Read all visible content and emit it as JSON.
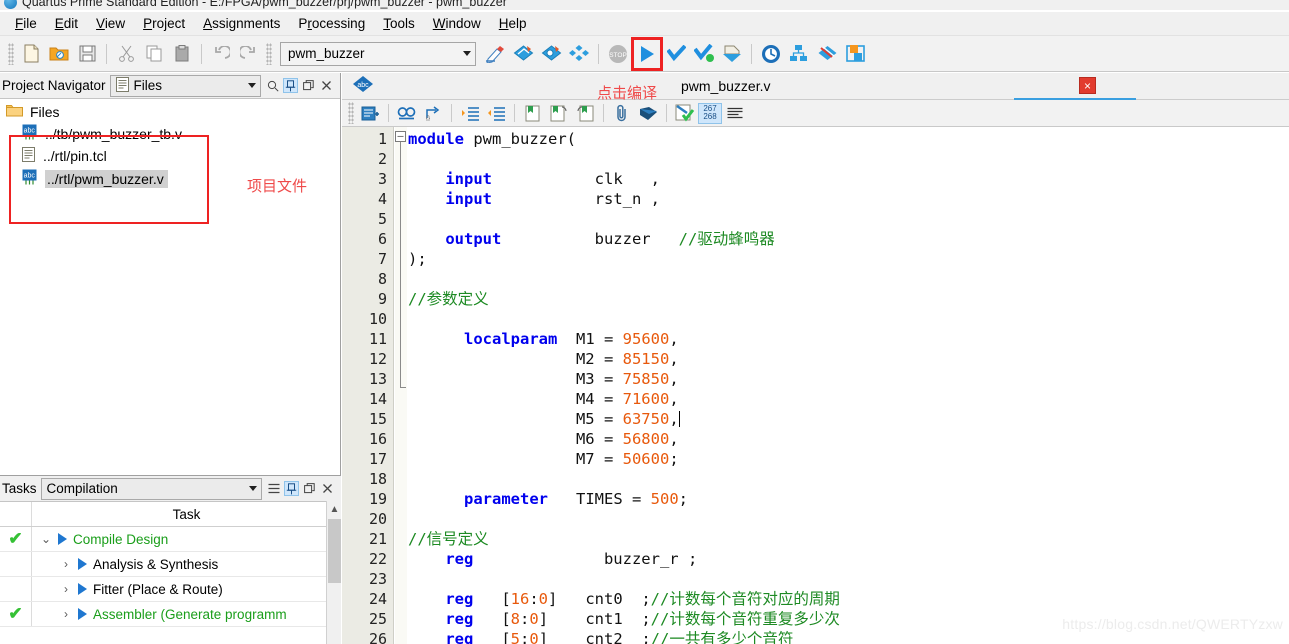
{
  "window": {
    "title": "Quartus Prime Standard Edition - E:/FPGA/pwm_buzzer/prj/pwm_buzzer - pwm_buzzer",
    "logo_icon": "quartus-logo-icon"
  },
  "menubar": {
    "items": [
      {
        "label": "File",
        "mnemonic": "F"
      },
      {
        "label": "Edit",
        "mnemonic": "E"
      },
      {
        "label": "View",
        "mnemonic": "V"
      },
      {
        "label": "Project",
        "mnemonic": "P"
      },
      {
        "label": "Assignments",
        "mnemonic": "A"
      },
      {
        "label": "Processing",
        "mnemonic": "r"
      },
      {
        "label": "Tools",
        "mnemonic": "T"
      },
      {
        "label": "Window",
        "mnemonic": "W"
      },
      {
        "label": "Help",
        "mnemonic": "H"
      }
    ]
  },
  "toolbar": {
    "project_combo_value": "pwm_buzzer",
    "buttons": [
      {
        "name": "new-file-icon",
        "title": "New"
      },
      {
        "name": "open-file-icon",
        "title": "Open"
      },
      {
        "name": "save-icon",
        "title": "Save"
      },
      {
        "name": "cut-icon",
        "title": "Cut"
      },
      {
        "name": "copy-icon",
        "title": "Copy"
      },
      {
        "name": "paste-icon",
        "title": "Paste"
      },
      {
        "name": "undo-icon",
        "title": "Undo"
      },
      {
        "name": "redo-icon",
        "title": "Redo"
      }
    ],
    "buttons2": [
      {
        "name": "rtl-editor-icon",
        "title": "Text Editor"
      },
      {
        "name": "settings-blue-icon",
        "title": "Settings"
      },
      {
        "name": "assignment-editor-icon",
        "title": "Assignment Editor"
      },
      {
        "name": "pin-planner-icon",
        "title": "Pin Planner"
      },
      {
        "name": "stop-icon",
        "title": "Stop Processing"
      },
      {
        "name": "start-compilation-icon",
        "title": "Start Compilation"
      },
      {
        "name": "start-analysis-synthesis-icon",
        "title": "Start Analysis & Synthesis"
      },
      {
        "name": "start-compilation-check-icon",
        "title": "Analysis & Elaboration"
      },
      {
        "name": "programmer-icon",
        "title": "Programmer"
      },
      {
        "name": "timing-analyzer-icon",
        "title": "Timing Analyzer"
      },
      {
        "name": "netlist-viewer-icon",
        "title": "Netlist Viewers"
      },
      {
        "name": "signaltap-icon",
        "title": "SignalTap"
      },
      {
        "name": "chip-planner-icon",
        "title": "Chip Planner"
      }
    ]
  },
  "project_navigator": {
    "panel_title": "Project Navigator",
    "view_combo_value": "Files",
    "view_combo_icon": "document-icon",
    "header_icons": [
      {
        "name": "search-icon",
        "glyph": "⌕",
        "active": false
      },
      {
        "name": "pin-icon",
        "glyph": "⌗",
        "active": true
      },
      {
        "name": "restore-icon",
        "glyph": "❐",
        "active": false
      },
      {
        "name": "close-icon",
        "glyph": "×",
        "active": false
      }
    ],
    "root_label": "Files",
    "root_icon": "folder-icon",
    "files": [
      {
        "label": "../tb/pwm_buzzer_tb.v",
        "icon": "verilog-file-icon",
        "selected": false
      },
      {
        "label": "../rtl/pin.tcl",
        "icon": "text-file-icon",
        "selected": false
      },
      {
        "label": "../rtl/pwm_buzzer.v",
        "icon": "verilog-file-icon",
        "selected": true
      }
    ],
    "annotation": "项目文件"
  },
  "tasks": {
    "panel_title": "Tasks",
    "flow_combo_value": "Compilation",
    "header_icons": [
      {
        "name": "menu-icon",
        "glyph": "≡",
        "active": false
      },
      {
        "name": "pin-icon",
        "glyph": "⌗",
        "active": true
      },
      {
        "name": "restore-icon",
        "glyph": "❐",
        "active": false
      },
      {
        "name": "close-icon",
        "glyph": "×",
        "active": false
      }
    ],
    "column_header": "Task",
    "rows": [
      {
        "status": "✔",
        "done": true,
        "expander": "⌄",
        "label": "Compile Design",
        "green": true,
        "indent": 0
      },
      {
        "status": "",
        "done": false,
        "expander": "›",
        "label": "Analysis & Synthesis",
        "green": false,
        "indent": 1
      },
      {
        "status": "",
        "done": false,
        "expander": "›",
        "label": "Fitter (Place & Route)",
        "green": false,
        "indent": 1
      },
      {
        "status": "✔",
        "done": true,
        "expander": "›",
        "label": "Assembler (Generate programm",
        "green": true,
        "indent": 1
      }
    ]
  },
  "editor": {
    "tab_label": "pwm_buzzer.v",
    "tab_icon": "verilog-file-icon",
    "close_button": "×",
    "annotation": "点击编译",
    "toolbar_buttons": [
      {
        "name": "insert-template-icon"
      },
      {
        "name": "find-icon"
      },
      {
        "name": "goto-icon"
      },
      {
        "name": "increase-indent-icon"
      },
      {
        "name": "decrease-indent-icon"
      },
      {
        "name": "bookmark-add-icon"
      },
      {
        "name": "bookmark-next-icon"
      },
      {
        "name": "bookmark-prev-icon"
      },
      {
        "name": "attach-icon"
      },
      {
        "name": "comment-icon"
      },
      {
        "name": "check-syntax-icon"
      },
      {
        "name": "line-numbers-icon",
        "label_top": "267",
        "label_bottom": "268"
      },
      {
        "name": "word-wrap-icon"
      }
    ],
    "line_count": 26,
    "lines": [
      {
        "n": 1,
        "tokens": [
          {
            "t": "module",
            "c": "kw"
          },
          {
            "t": " pwm_buzzer(",
            "c": "pl"
          }
        ]
      },
      {
        "n": 2,
        "tokens": []
      },
      {
        "n": 3,
        "tokens": [
          {
            "t": "    ",
            "c": "pl"
          },
          {
            "t": "input",
            "c": "kw"
          },
          {
            "t": "           clk   ,",
            "c": "pl"
          }
        ]
      },
      {
        "n": 4,
        "tokens": [
          {
            "t": "    ",
            "c": "pl"
          },
          {
            "t": "input",
            "c": "kw"
          },
          {
            "t": "           rst_n ,",
            "c": "pl"
          }
        ]
      },
      {
        "n": 5,
        "tokens": []
      },
      {
        "n": 6,
        "tokens": [
          {
            "t": "    ",
            "c": "pl"
          },
          {
            "t": "output",
            "c": "kw"
          },
          {
            "t": "          buzzer   ",
            "c": "pl"
          },
          {
            "t": "//驱动蜂鸣器",
            "c": "cmt"
          }
        ]
      },
      {
        "n": 7,
        "tokens": [
          {
            "t": ");",
            "c": "pl"
          }
        ]
      },
      {
        "n": 8,
        "tokens": []
      },
      {
        "n": 9,
        "tokens": [
          {
            "t": "//参数定义",
            "c": "cmt"
          }
        ]
      },
      {
        "n": 10,
        "tokens": []
      },
      {
        "n": 11,
        "tokens": [
          {
            "t": "      ",
            "c": "pl"
          },
          {
            "t": "localparam",
            "c": "kw"
          },
          {
            "t": "  M1 = ",
            "c": "pl"
          },
          {
            "t": "95600",
            "c": "num"
          },
          {
            "t": ",",
            "c": "pl"
          }
        ]
      },
      {
        "n": 12,
        "tokens": [
          {
            "t": "                  M2 = ",
            "c": "pl"
          },
          {
            "t": "85150",
            "c": "num"
          },
          {
            "t": ",",
            "c": "pl"
          }
        ]
      },
      {
        "n": 13,
        "tokens": [
          {
            "t": "                  M3 = ",
            "c": "pl"
          },
          {
            "t": "75850",
            "c": "num"
          },
          {
            "t": ",",
            "c": "pl"
          }
        ]
      },
      {
        "n": 14,
        "tokens": [
          {
            "t": "                  M4 = ",
            "c": "pl"
          },
          {
            "t": "71600",
            "c": "num"
          },
          {
            "t": ",",
            "c": "pl"
          }
        ]
      },
      {
        "n": 15,
        "tokens": [
          {
            "t": "                  M5 = ",
            "c": "pl"
          },
          {
            "t": "63750",
            "c": "num"
          },
          {
            "t": ",",
            "c": "pl"
          }
        ]
      },
      {
        "n": 16,
        "tokens": [
          {
            "t": "                  M6 = ",
            "c": "pl"
          },
          {
            "t": "56800",
            "c": "num"
          },
          {
            "t": ",",
            "c": "pl"
          }
        ]
      },
      {
        "n": 17,
        "tokens": [
          {
            "t": "                  M7 = ",
            "c": "pl"
          },
          {
            "t": "50600",
            "c": "num"
          },
          {
            "t": ";",
            "c": "pl"
          }
        ]
      },
      {
        "n": 18,
        "tokens": []
      },
      {
        "n": 19,
        "tokens": [
          {
            "t": "      ",
            "c": "pl"
          },
          {
            "t": "parameter",
            "c": "kw"
          },
          {
            "t": "   TIMES = ",
            "c": "pl"
          },
          {
            "t": "500",
            "c": "num"
          },
          {
            "t": ";",
            "c": "pl"
          }
        ]
      },
      {
        "n": 20,
        "tokens": []
      },
      {
        "n": 21,
        "tokens": [
          {
            "t": "//信号定义",
            "c": "cmt"
          }
        ]
      },
      {
        "n": 22,
        "tokens": [
          {
            "t": "    ",
            "c": "pl"
          },
          {
            "t": "reg",
            "c": "kw"
          },
          {
            "t": "              buzzer_r ;",
            "c": "pl"
          }
        ]
      },
      {
        "n": 23,
        "tokens": []
      },
      {
        "n": 24,
        "tokens": [
          {
            "t": "    ",
            "c": "pl"
          },
          {
            "t": "reg",
            "c": "kw"
          },
          {
            "t": "   [",
            "c": "pl"
          },
          {
            "t": "16",
            "c": "num"
          },
          {
            "t": ":",
            "c": "pl"
          },
          {
            "t": "0",
            "c": "num"
          },
          {
            "t": "]   cnt0  ;",
            "c": "pl"
          },
          {
            "t": "//计数每个音符对应的周期",
            "c": "cmt"
          }
        ]
      },
      {
        "n": 25,
        "tokens": [
          {
            "t": "    ",
            "c": "pl"
          },
          {
            "t": "reg",
            "c": "kw"
          },
          {
            "t": "   [",
            "c": "pl"
          },
          {
            "t": "8",
            "c": "num"
          },
          {
            "t": ":",
            "c": "pl"
          },
          {
            "t": "0",
            "c": "num"
          },
          {
            "t": "]    cnt1  ;",
            "c": "pl"
          },
          {
            "t": "//计数每个音符重复多少次",
            "c": "cmt"
          }
        ]
      },
      {
        "n": 26,
        "tokens": [
          {
            "t": "    ",
            "c": "pl"
          },
          {
            "t": "reg",
            "c": "kw"
          },
          {
            "t": "   [",
            "c": "pl"
          },
          {
            "t": "5",
            "c": "num"
          },
          {
            "t": ":",
            "c": "pl"
          },
          {
            "t": "0",
            "c": "num"
          },
          {
            "t": "]    cnt2  ;",
            "c": "pl"
          },
          {
            "t": "//一共有多少个音符",
            "c": "cmt"
          }
        ]
      }
    ]
  },
  "watermark": "https://blog.csdn.net/QWERTYzxw",
  "colors": {
    "accent_red": "#ee2222",
    "anno_red": "#ef4a4a",
    "keyword_blue": "#0000ee",
    "number_orange": "#e8590c",
    "comment_green": "#1d8a23",
    "task_green": "#35c135",
    "tab_underline": "#3a9fe0"
  }
}
